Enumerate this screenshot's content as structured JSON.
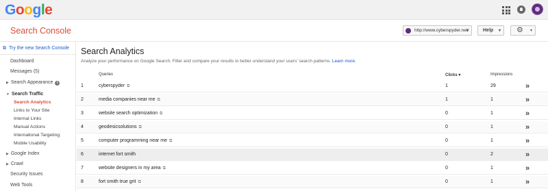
{
  "topbar": {
    "logo_letters": [
      {
        "ch": "G",
        "color": "#4285f4"
      },
      {
        "ch": "o",
        "color": "#ea4335"
      },
      {
        "ch": "o",
        "color": "#fbbc05"
      },
      {
        "ch": "g",
        "color": "#4285f4"
      },
      {
        "ch": "l",
        "color": "#34a853"
      },
      {
        "ch": "e",
        "color": "#ea4335"
      }
    ],
    "icons": [
      "apps-icon",
      "notifications-icon",
      "account-avatar"
    ]
  },
  "header": {
    "title": "Search Console",
    "site": "http://www.cyberspyder.net/",
    "help_label": "Help",
    "caret": "▾",
    "gear": "⚙"
  },
  "sidebar": {
    "new_console": "Try the new Search Console",
    "items": [
      "Dashboard",
      "Messages (5)",
      "Search Appearance",
      "Search Traffic",
      "Search Analytics",
      "Links to Your Site",
      "Internal Links",
      "Manual Actions",
      "International Targeting",
      "Mobile Usability",
      "Google Index",
      "Crawl",
      "Security Issues",
      "Web Tools"
    ],
    "info": "i",
    "tri_right": "▶",
    "tri_down": "▼"
  },
  "main": {
    "title": "Search Analytics",
    "description": "Analyze your performance on Google Search. Filter and compare your results to better understand your users' search patterns.",
    "learn_more": "Learn more.",
    "columns": {
      "queries": "Queries",
      "clicks": "Clicks ▾",
      "impressions": "Impressions"
    },
    "rows": [
      {
        "n": "1",
        "q": "cyberspyder",
        "clicks": "1",
        "impressions": "29"
      },
      {
        "n": "2",
        "q": "media companies near me",
        "clicks": "1",
        "impressions": "1"
      },
      {
        "n": "3",
        "q": "website search optimization",
        "clicks": "0",
        "impressions": "1"
      },
      {
        "n": "4",
        "q": "geodesicsolutions",
        "clicks": "0",
        "impressions": "1"
      },
      {
        "n": "5",
        "q": "computer programming near me",
        "clicks": "0",
        "impressions": "1"
      },
      {
        "n": "6",
        "q": "internet fort smith",
        "clicks": "0",
        "impressions": "2"
      },
      {
        "n": "7",
        "q": "website designers in my area",
        "clicks": "0",
        "impressions": "1"
      },
      {
        "n": "8",
        "q": "fort smith true grit",
        "clicks": "0",
        "impressions": "1"
      }
    ],
    "row_go": "»",
    "ext_glyph": "⧉"
  }
}
